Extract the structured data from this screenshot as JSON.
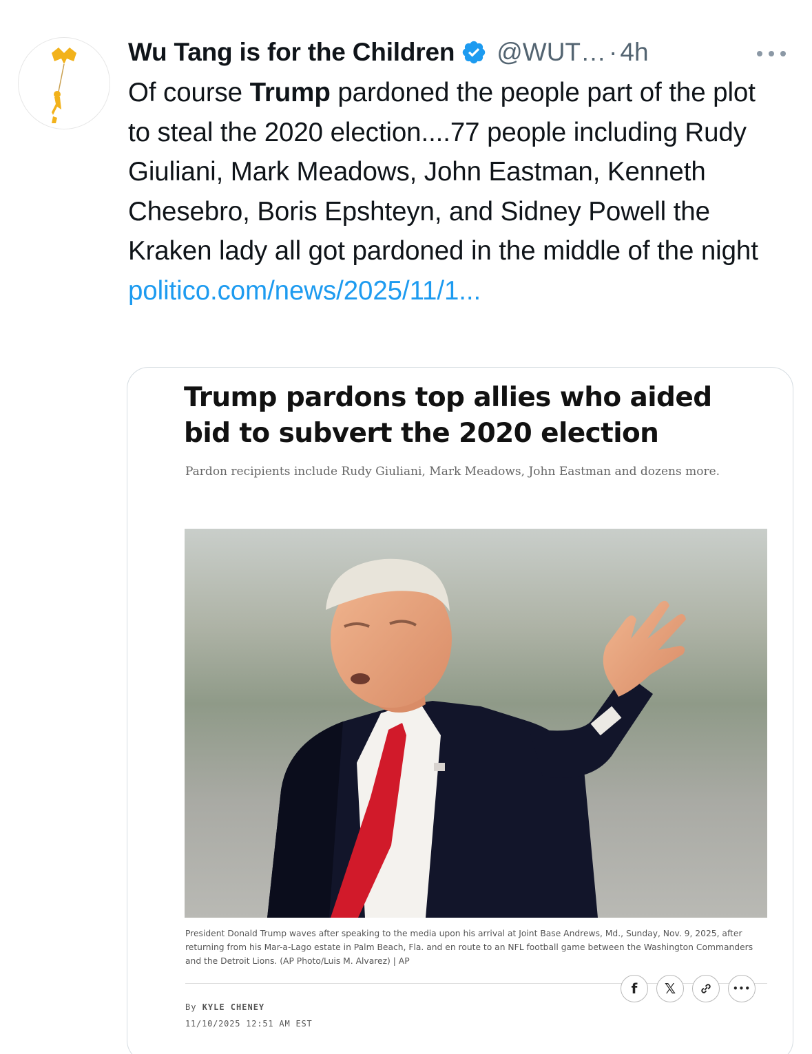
{
  "tweet": {
    "author": {
      "display_name": "Wu Tang is for the Children",
      "verified": true,
      "handle": "@WUT…",
      "separator": "·",
      "time": "4h",
      "avatar_icon": "wu-tang-balloon-logo",
      "avatar_color": "#f2b21b"
    },
    "text": {
      "before_bold": "Of course ",
      "bold": "Trump",
      "after_bold": " pardoned the people part of the plot to steal the 2020 election....77 people including Rudy Giuliani, Mark Meadows, John Eastman, Kenneth Chesebro, Boris Epshteyn, and Sidney Powell the Kraken lady all got pardoned in the middle of the night",
      "link": "politico.com/news/2025/11/1..."
    },
    "more_icon": "more-horizontal-icon",
    "accent_color": "#1d9bf0"
  },
  "card": {
    "headline": "Trump pardons top allies who aided bid to subvert the 2020 election",
    "dek": "Pardon recipients include Rudy Giuliani, Mark Meadows, John Eastman and dozens more.",
    "caption": "President Donald Trump waves after speaking to the media upon his arrival at Joint Base Andrews, Md., Sunday, Nov. 9, 2025, after returning from his Mar-a-Lago estate in Palm Beach, Fla. and en route to an NFL football game between the Washington Commanders and the Detroit Lions. (AP Photo/Luis M. Alvarez) | AP",
    "byline_prefix": "By",
    "author": "KYLE CHENEY",
    "date": "11/10/2025 12:51 AM EST",
    "share_buttons": [
      {
        "name": "facebook",
        "glyph": "f"
      },
      {
        "name": "x",
        "glyph": "𝕏"
      },
      {
        "name": "link",
        "glyph": "🔗"
      },
      {
        "name": "more",
        "glyph": "•••"
      }
    ]
  }
}
